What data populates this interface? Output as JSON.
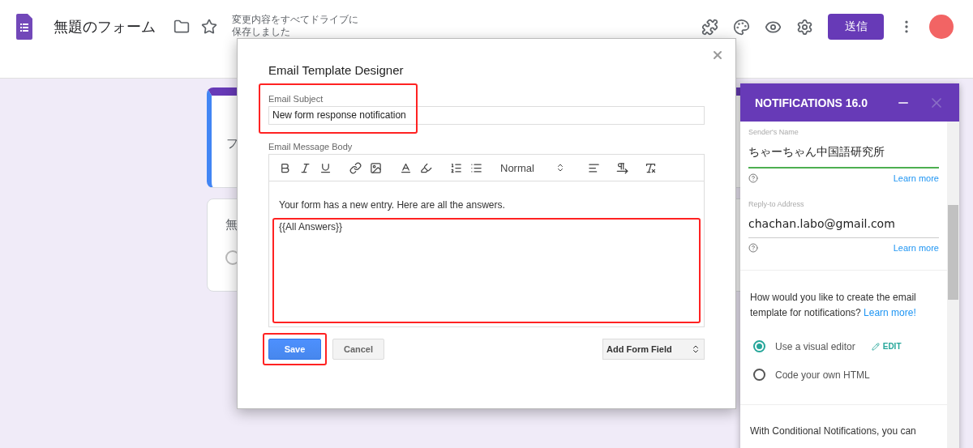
{
  "header": {
    "title": "無題のフォーム",
    "save_status": "変更内容をすべてドライブに保存しました",
    "send_button": "送信"
  },
  "form_cards": [
    {
      "kind": "title",
      "text": "フ"
    },
    {
      "kind": "question",
      "text": "無"
    }
  ],
  "dialog": {
    "title": "Email Template Designer",
    "subject_label": "Email Subject",
    "subject_value": "New form response notification",
    "body_label": "Email Message Body",
    "format_select": "Normal",
    "body_lines": [
      "Your form has a new entry. Here are all the answers.",
      "{{All Answers}}"
    ],
    "buttons": [
      {
        "label": "Save",
        "kind": "primary"
      },
      {
        "label": "Cancel",
        "kind": "secondary"
      }
    ],
    "field_select": "Add Form Field"
  },
  "panel": {
    "title": "NOTIFICATIONS 16.0",
    "fields": [
      {
        "label": "Sender's Name",
        "value": "ちゃーちゃん中国語研究所",
        "focused": true,
        "help_link": "Learn more"
      },
      {
        "label": "Reply-to Address",
        "value": "chachan.labo@gmail.com",
        "focused": false,
        "help_link": "Learn more"
      }
    ],
    "question": "How would you like to create the email template for notifications?",
    "question_link": "Learn more!",
    "options": [
      {
        "label": "Use a visual editor",
        "selected": true,
        "action": "EDIT"
      },
      {
        "label": "Code your own HTML",
        "selected": false
      }
    ],
    "footer_text": "With Conditional Notifications, you can"
  }
}
